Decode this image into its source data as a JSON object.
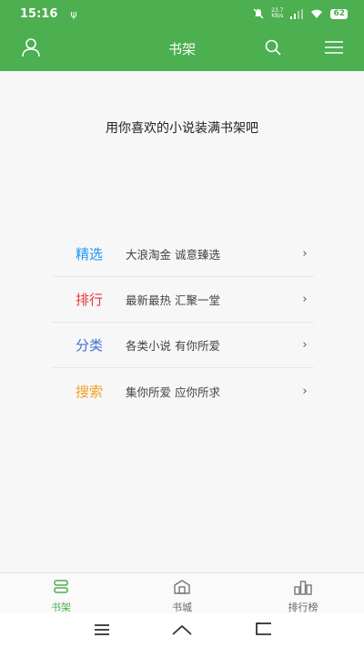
{
  "status_bar": {
    "time": "15:16",
    "usb": "ψ",
    "net_speed_value": "23.7",
    "net_speed_unit": "KB/s",
    "battery": "62"
  },
  "app_bar": {
    "title": "书架",
    "user_icon": "user-icon",
    "search_icon": "search-icon",
    "menu_icon": "hamburger-menu-icon",
    "color": "#4caf50"
  },
  "main": {
    "empty_message": "用你喜欢的小说装满书架吧",
    "entries": [
      {
        "label": "精选",
        "description": "大浪淘金  诚意臻选",
        "color": "#2196f3"
      },
      {
        "label": "排行",
        "description": "最新最热  汇聚一堂",
        "color": "#e53935"
      },
      {
        "label": "分类",
        "description": "各类小说  有你所爱",
        "color": "#3f6fd8"
      },
      {
        "label": "搜索",
        "description": "集你所爱  应你所求",
        "color": "#f0a020"
      }
    ],
    "chevron": "›"
  },
  "tab_bar": {
    "tabs": [
      {
        "label": "书架",
        "icon": "bookshelf-icon",
        "active": true
      },
      {
        "label": "书城",
        "icon": "bookstore-icon",
        "active": false
      },
      {
        "label": "排行榜",
        "icon": "ranking-icon",
        "active": false
      }
    ],
    "active_color": "#4caf50"
  },
  "nav_bar": {
    "buttons": [
      "recent-apps-icon",
      "home-icon",
      "back-icon"
    ]
  }
}
